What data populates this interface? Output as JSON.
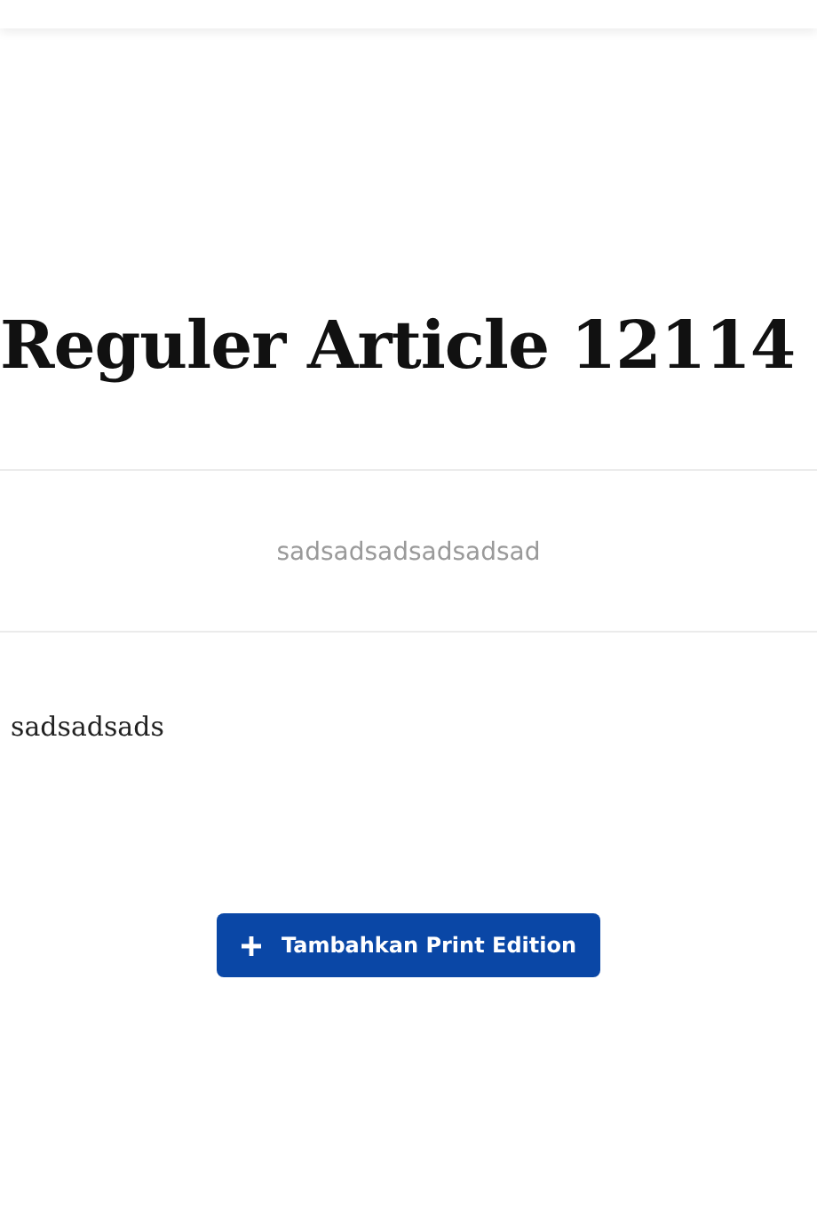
{
  "title": "Reguler Article 12114",
  "subtitle": "sadsadsadsadsadsad",
  "body": "sadsadsads",
  "button": {
    "label": "Tambahkan Print Edition"
  }
}
